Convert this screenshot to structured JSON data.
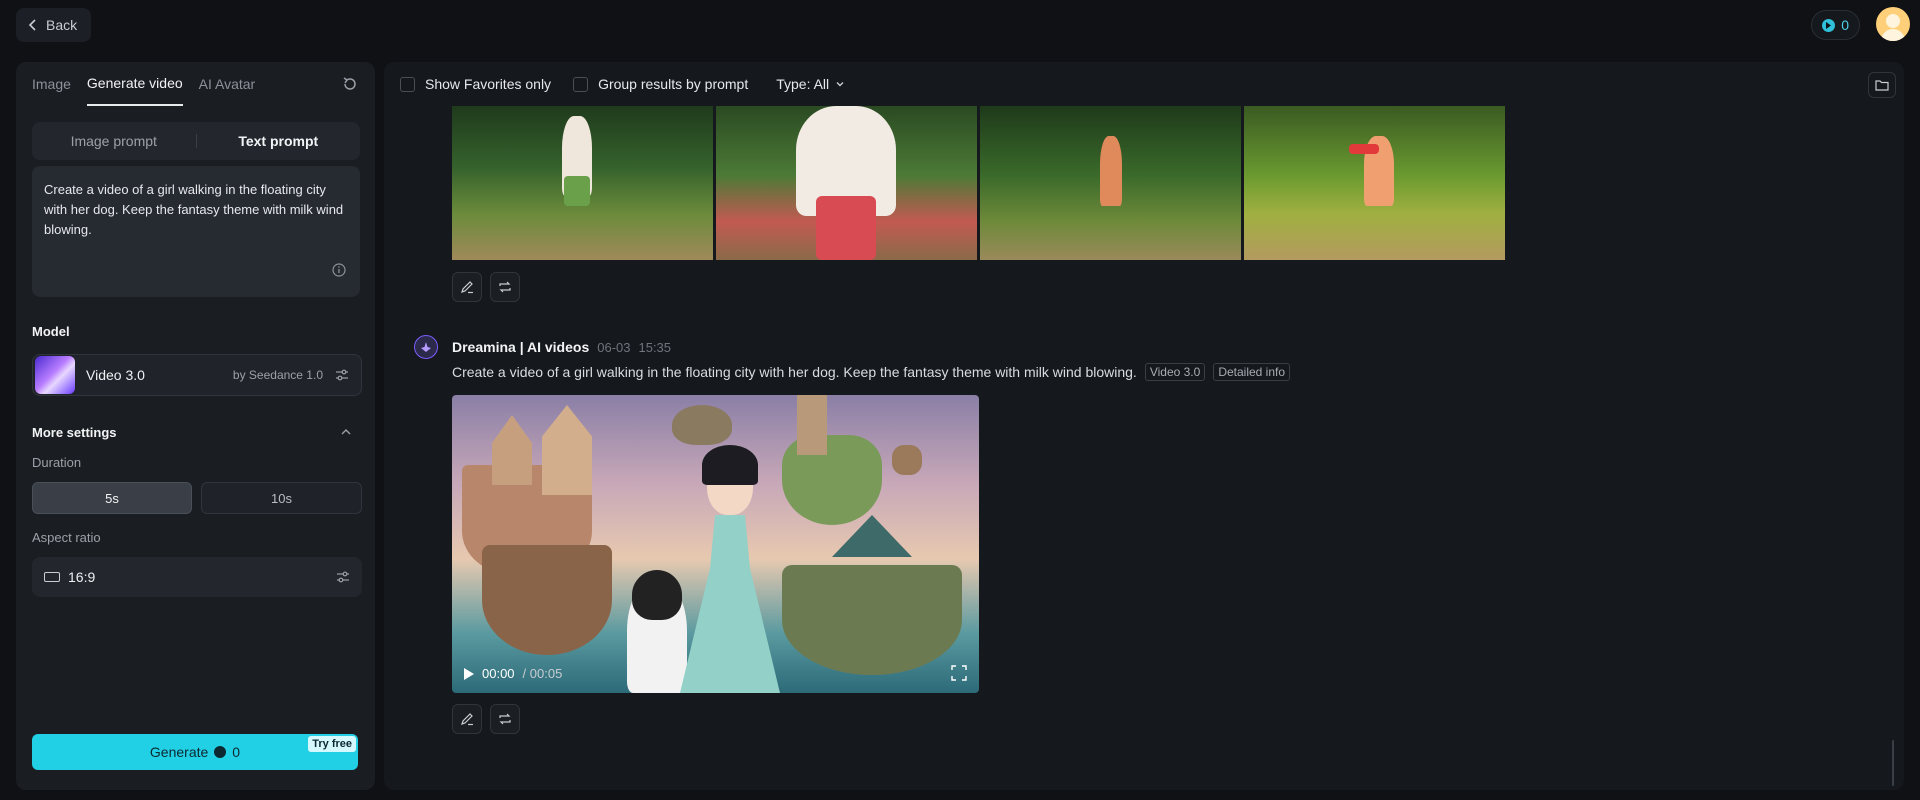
{
  "topbar": {
    "back_label": "Back",
    "credits": "0"
  },
  "left": {
    "tabs": [
      {
        "label": "Image"
      },
      {
        "label": "Generate video"
      },
      {
        "label": "AI Avatar"
      }
    ],
    "prompt_modes": [
      {
        "label": "Image prompt"
      },
      {
        "label": "Text prompt"
      }
    ],
    "prompt_text": "Create a video of a girl walking in the floating city with her dog. Keep the fantasy theme with milk wind blowing.",
    "model_section": "Model",
    "model": {
      "name": "Video 3.0",
      "by": "by Seedance 1.0"
    },
    "more_settings": "More settings",
    "duration_label": "Duration",
    "durations": [
      {
        "label": "5s"
      },
      {
        "label": "10s"
      }
    ],
    "aspect_label": "Aspect ratio",
    "aspect_value": "16:9",
    "generate_label": "Generate",
    "generate_cost": "0",
    "try_free": "Try free"
  },
  "right": {
    "filters": {
      "favorites": "Show Favorites only",
      "group": "Group results by prompt",
      "type": "Type: All"
    },
    "message": {
      "author": "Dreamina | AI videos",
      "date": "06-03",
      "time": "15:35",
      "prompt": "Create a video of a girl walking in the floating city with her dog. Keep the fantasy theme with milk wind blowing.",
      "tags": [
        {
          "label": "Video 3.0"
        },
        {
          "label": "Detailed info"
        }
      ],
      "video_time": "00:00",
      "video_duration": "/ 00:05"
    }
  },
  "colors": {
    "accent": "#22d0e6",
    "bg": "#0f1115",
    "panel": "#1a1d22",
    "bot_ring": "#7b5cff"
  },
  "icons": [
    "chevron-left-icon",
    "credit-icon",
    "refresh-icon",
    "info-icon",
    "settings-sliders-icon",
    "chevron-up-icon",
    "aspect-ratio-icon",
    "chevron-down-icon",
    "folder-icon",
    "edit-icon",
    "regenerate-icon",
    "play-icon",
    "fullscreen-icon"
  ]
}
